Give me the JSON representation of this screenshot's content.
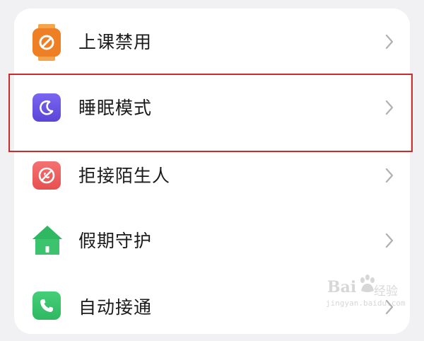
{
  "settings_list": {
    "items": [
      {
        "label": "上课禁用",
        "icon": "no-entry-icon",
        "icon_color": "#f0862e"
      },
      {
        "label": "睡眠模式",
        "icon": "moon-icon",
        "icon_color": "#6a55e6"
      },
      {
        "label": "拒接陌生人",
        "icon": "block-call-icon",
        "icon_color": "#f06060"
      },
      {
        "label": "假期守护",
        "icon": "house-icon",
        "icon_color": "#36c46a"
      },
      {
        "label": "自动接通",
        "icon": "phone-icon",
        "icon_color": "#36c46a"
      }
    ]
  },
  "annotation": {
    "highlight_color": "#cc2b2b"
  },
  "watermark": {
    "brand": "Bai",
    "brand_cn": "经验",
    "url": "jingyan.baidu.com"
  },
  "colors": {
    "background": "#f1f1f3",
    "card": "#ffffff",
    "chevron": "#b0b0b0"
  }
}
